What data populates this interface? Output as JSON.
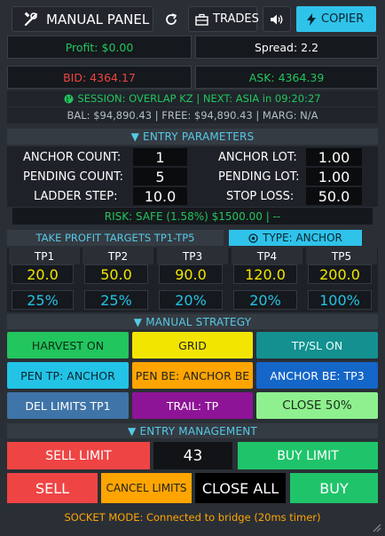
{
  "header": {
    "title": "MANUAL PANEL",
    "trades_label": "TRADES",
    "copier_label": "COPIER"
  },
  "stats": {
    "profit": "Profit: $0.00",
    "spread": "Spread: 2.2",
    "bid": "BID: 4364.17",
    "ask": "ASK: 4364.39",
    "session": "SESSION: OVERLAP KZ | NEXT: ASIA in 09:20:27",
    "balance": "BAL: $94,890.43 | FREE: $94,890.43 | MARG: N/A"
  },
  "entry_params": {
    "section_title": "▼ ENTRY PARAMETERS",
    "anchor_count_label": "ANCHOR COUNT:",
    "anchor_count": "1",
    "anchor_lot_label": "ANCHOR LOT:",
    "anchor_lot": "1.00",
    "pending_count_label": "PENDING COUNT:",
    "pending_count": "5",
    "pending_lot_label": "PENDING LOT:",
    "pending_lot": "1.00",
    "ladder_step_label": "LADDER STEP:",
    "ladder_step": "10.0",
    "stop_loss_label": "STOP LOSS:",
    "stop_loss": "50.0",
    "risk": "RISK: SAFE (1.58%) $1500.00 | --"
  },
  "tp": {
    "tab_targets": "TAKE PROFIT TARGETS TP1-TP5",
    "tab_type": "TYPE: ANCHOR",
    "columns": [
      {
        "label": "TP1",
        "price": "20.0",
        "pct": "25%"
      },
      {
        "label": "TP2",
        "price": "50.0",
        "pct": "25%"
      },
      {
        "label": "TP3",
        "price": "90.0",
        "pct": "20%"
      },
      {
        "label": "TP4",
        "price": "120.0",
        "pct": "20%"
      },
      {
        "label": "TP5",
        "price": "200.0",
        "pct": "100%"
      }
    ]
  },
  "strategy": {
    "section_title": "▼ MANUAL STRATEGY",
    "harvest": "HARVEST ON",
    "grid": "GRID",
    "tpsl": "TP/SL ON",
    "pen_tp": "PEN TP: ANCHOR",
    "pen_be": "PEN BE: ANCHOR BE",
    "anchor_be": "ANCHOR BE: TP3",
    "del_limits": "DEL LIMITS TP1",
    "trail": "TRAIL: TP",
    "close50": "CLOSE 50%"
  },
  "entry_mgmt": {
    "section_title": "▼ ENTRY MANAGEMENT",
    "sell_limit": "SELL LIMIT",
    "distance": "43",
    "buy_limit": "BUY LIMIT",
    "sell": "SELL",
    "cancel_limits": "CANCEL LIMITS",
    "close_all": "CLOSE ALL",
    "buy": "BUY"
  },
  "footer": {
    "socket": "SOCKET MODE: Connected to bridge (20ms timer)"
  },
  "icons": {
    "tools": "tools-icon",
    "refresh": "refresh-icon",
    "briefcase": "briefcase-icon",
    "speaker": "speaker-icon",
    "lightning": "lightning-icon",
    "globe": "globe-icon",
    "target": "target-icon",
    "resize": "resize-grip-icon"
  },
  "colors": {
    "green": "#22c55e",
    "red": "#ef4444",
    "cyan": "#22c3e6",
    "yellow": "#f2e600",
    "orange": "#ffa500"
  }
}
